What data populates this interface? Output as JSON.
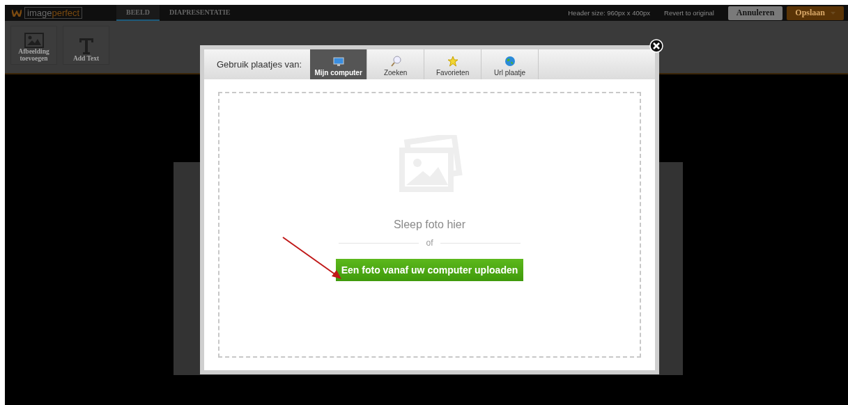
{
  "app": {
    "logo_first": "image",
    "logo_second": "perfect"
  },
  "nav_tabs": [
    {
      "label": "BEELD",
      "selected": true
    },
    {
      "label": "DIAPRESENTATIE",
      "selected": false
    }
  ],
  "header_size": "Header size: 960px x 400px",
  "revert_link": "Revert to original",
  "buttons": [
    {
      "label": "Annuleren",
      "kind": "secondary"
    },
    {
      "label": "Opslaan",
      "kind": "primary"
    }
  ],
  "tools": [
    {
      "label": "Afbeelding toevoegen",
      "kind": "image"
    },
    {
      "label": "Add Text",
      "kind": "text"
    }
  ],
  "dialog": {
    "source_label": "Gebruik plaatjes van:",
    "tabs": [
      {
        "label": "Mijn computer",
        "kind": "computer",
        "selected": true
      },
      {
        "label": "Zoeken",
        "kind": "search",
        "selected": false
      },
      {
        "label": "Favorieten",
        "kind": "star",
        "selected": false
      },
      {
        "label": "Url plaatje",
        "kind": "globe",
        "selected": false
      }
    ],
    "drop_title": "Sleep foto hier",
    "separator": "of",
    "upload_button": "Een foto vanaf uw computer uploaden"
  }
}
